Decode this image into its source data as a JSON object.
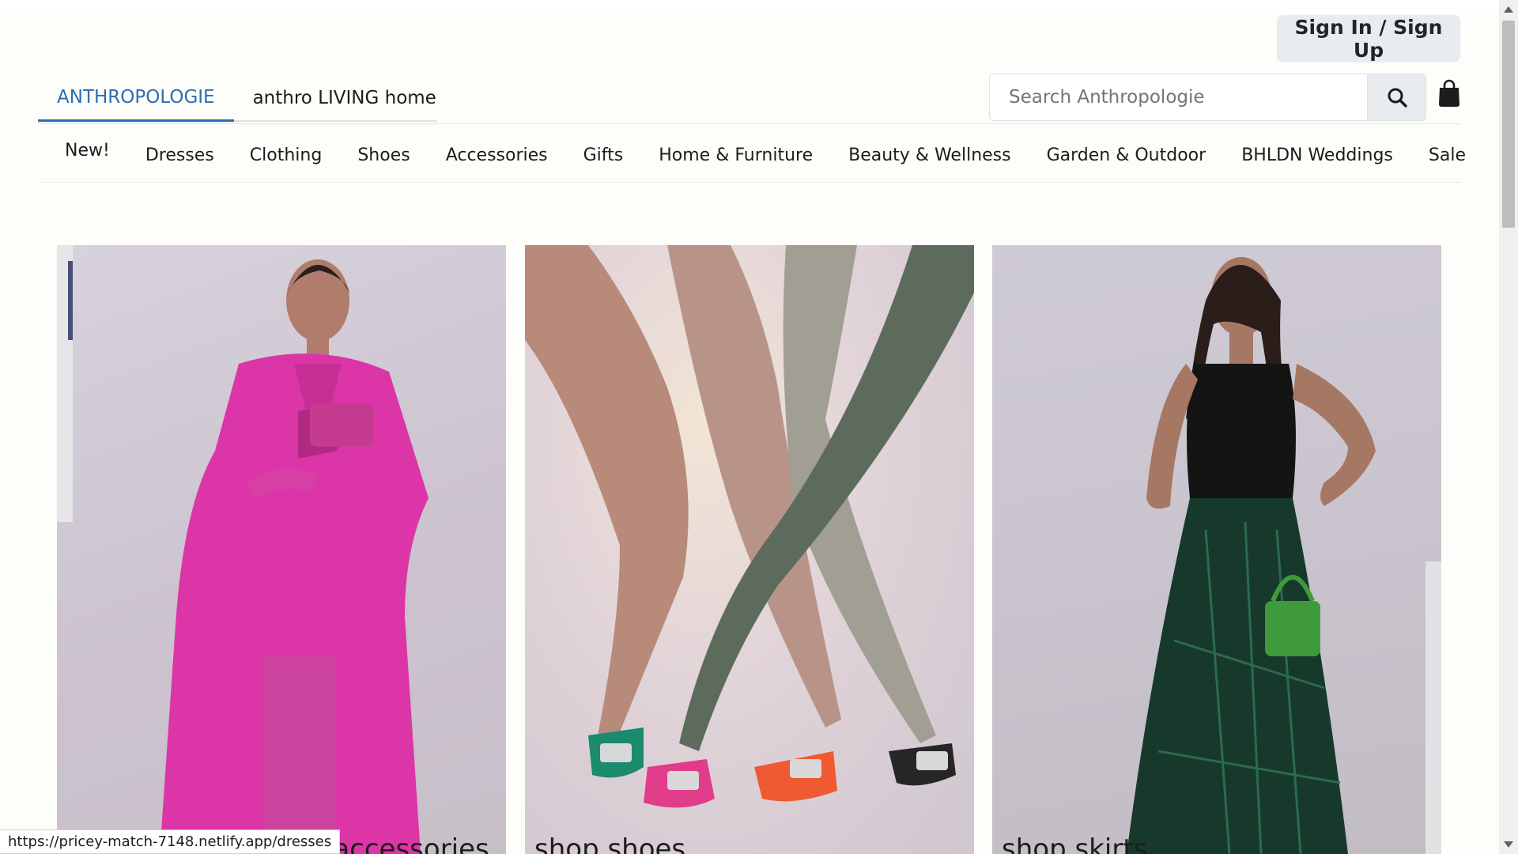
{
  "header": {
    "sign_in_label": "Sign In / Sign Up",
    "brand_tabs": [
      {
        "label": "ANTHROPOLOGIE",
        "active": true
      },
      {
        "label": "anthro LIVING home",
        "active": false
      }
    ],
    "search": {
      "placeholder": "Search Anthropologie",
      "value": ""
    },
    "icons": {
      "search": "search-icon",
      "cart": "shopping-bag-icon"
    }
  },
  "nav": {
    "items": [
      "New!",
      "Dresses",
      "Clothing",
      "Shoes",
      "Accessories",
      "Gifts",
      "Home & Furniture",
      "Beauty & Wellness",
      "Garden & Outdoor",
      "BHLDN Weddings",
      "Sale"
    ]
  },
  "cards": [
    {
      "label": "& accessories"
    },
    {
      "label": "shop shoes"
    },
    {
      "label": "shop skirts"
    }
  ],
  "status_bar": {
    "url": "https://pricey-match-7148.netlify.app/dresses"
  },
  "colors": {
    "page_bg": "#fdfdf9",
    "accent": "#2c6cb3",
    "button_bg": "#e9ecef"
  }
}
